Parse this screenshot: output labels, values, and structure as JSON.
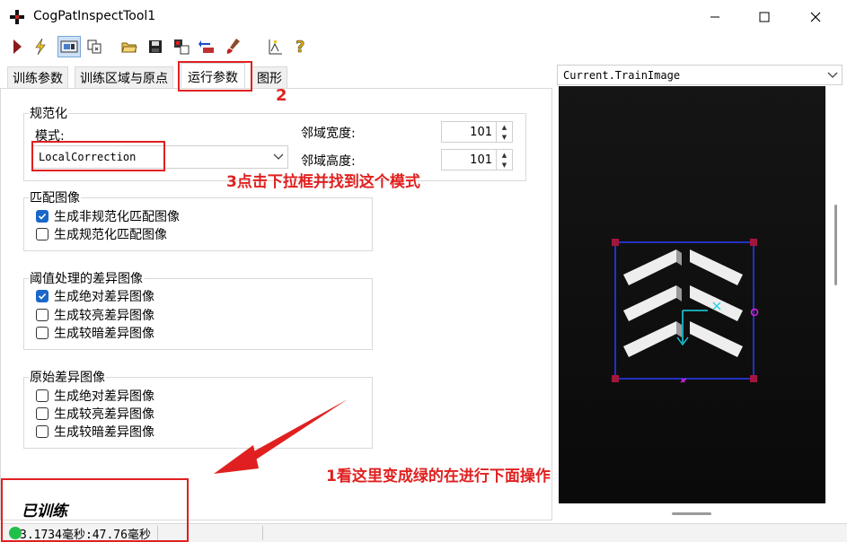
{
  "window": {
    "title": "CogPatInspectTool1",
    "minimize_icon": "minimize-icon",
    "maximize_icon": "maximize-icon",
    "close_icon": "close-icon"
  },
  "toolbar": {
    "icons": [
      "run-icon",
      "lightning-icon",
      "image-view-icon",
      "copy-icon",
      "open-folder-icon",
      "save-icon",
      "settings-io-icon",
      "reset-icon",
      "brush-icon",
      "chart-icon",
      "help-icon"
    ]
  },
  "tabs": [
    {
      "label": "训练参数"
    },
    {
      "label": "训练区域与原点"
    },
    {
      "label": "运行参数"
    },
    {
      "label": "图形"
    }
  ],
  "normalization": {
    "group_label": "规范化",
    "mode_label": "模式:",
    "mode_value": "LocalCorrection",
    "width_label": "邻域宽度:",
    "width_value": "101",
    "height_label": "邻域高度:",
    "height_value": "101"
  },
  "match_image": {
    "group_label": "匹配图像",
    "options": [
      {
        "label": "生成非规范化匹配图像",
        "checked": true
      },
      {
        "label": "生成规范化匹配图像",
        "checked": false
      }
    ]
  },
  "threshold_diff": {
    "group_label": "阈值处理的差异图像",
    "options": [
      {
        "label": "生成绝对差异图像",
        "checked": true
      },
      {
        "label": "生成较亮差异图像",
        "checked": false
      },
      {
        "label": "生成较暗差异图像",
        "checked": false
      }
    ]
  },
  "raw_diff": {
    "group_label": "原始差异图像",
    "options": [
      {
        "label": "生成绝对差异图像",
        "checked": false
      },
      {
        "label": "生成较亮差异图像",
        "checked": false
      },
      {
        "label": "生成较暗差异图像",
        "checked": false
      }
    ]
  },
  "image_view": {
    "selector_value": "Current.TrainImage"
  },
  "status": {
    "trained_label": "已训练",
    "timing": "3.1734毫秒:47.76毫秒",
    "led_color": "#22c04a"
  },
  "annotations": {
    "step1": "1看这里变成绿的在进行下面操作",
    "step2": "2",
    "step3": "3点击下拉框并找到这个模式",
    "color": "#e02020"
  }
}
